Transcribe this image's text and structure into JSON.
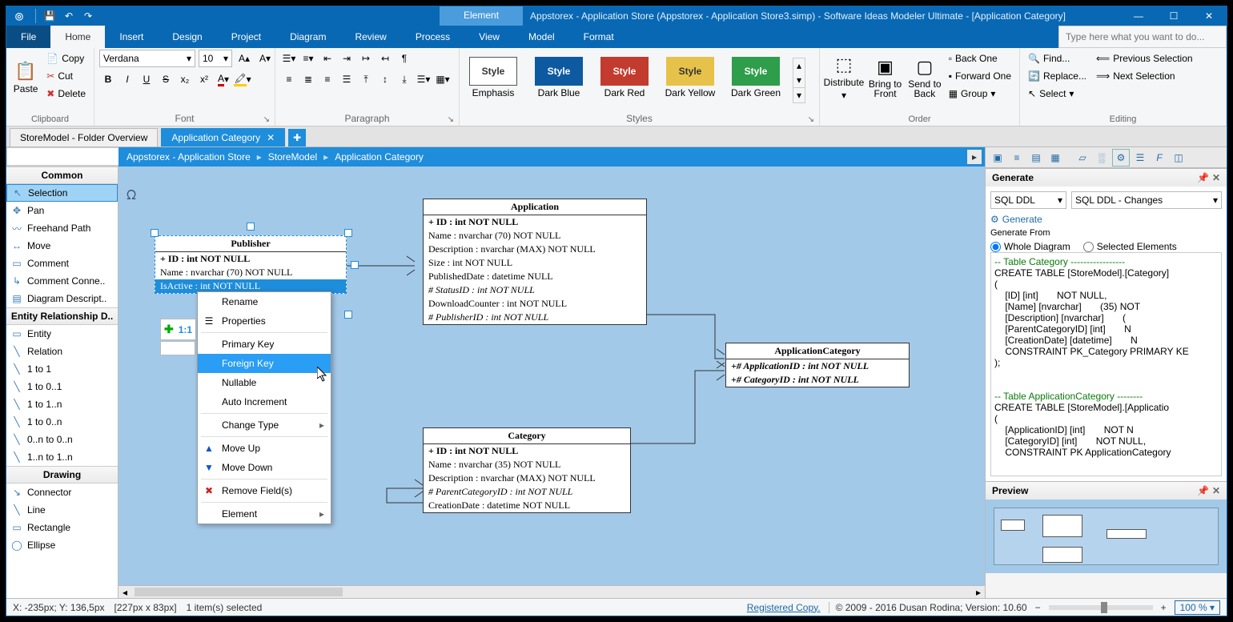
{
  "titlebar": {
    "context_tab": "Element",
    "title": "Appstorex - Application Store (Appstorex - Application Store3.simp)  - Software Ideas Modeler Ultimate - [Application Category]"
  },
  "menu": {
    "file": "File",
    "home": "Home",
    "insert": "Insert",
    "design": "Design",
    "project": "Project",
    "diagram": "Diagram",
    "review": "Review",
    "process": "Process",
    "view": "View",
    "model": "Model",
    "format": "Format",
    "search_placeholder": "Type here what you want to do..."
  },
  "ribbon": {
    "clipboard": {
      "paste": "Paste",
      "copy": "Copy",
      "cut": "Cut",
      "delete": "Delete",
      "title": "Clipboard"
    },
    "font": {
      "name": "Verdana",
      "size": "10",
      "title": "Font"
    },
    "paragraph": {
      "title": "Paragraph"
    },
    "styles": {
      "title": "Styles",
      "items": [
        {
          "label": "Emphasis",
          "box": "Style",
          "bg": "#ffffff",
          "color": "#333",
          "border": "#555"
        },
        {
          "label": "Dark Blue",
          "box": "Style",
          "bg": "#0d5aa0",
          "color": "#fff",
          "border": "#0d5aa0"
        },
        {
          "label": "Dark Red",
          "box": "Style",
          "bg": "#c23b2e",
          "color": "#fff",
          "border": "#c23b2e"
        },
        {
          "label": "Dark Yellow",
          "box": "Style",
          "bg": "#e6c24a",
          "color": "#333",
          "border": "#e6c24a"
        },
        {
          "label": "Dark Green",
          "box": "Style",
          "bg": "#2e9e4a",
          "color": "#fff",
          "border": "#2e9e4a"
        }
      ]
    },
    "order": {
      "distribute": "Distribute",
      "front": "Bring to\nFront",
      "back": "Send to\nBack",
      "back_one": "Back One",
      "forward_one": "Forward One",
      "group": "Group",
      "title": "Order"
    },
    "editing": {
      "find": "Find...",
      "replace": "Replace...",
      "select": "Select",
      "prev": "Previous Selection",
      "next": "Next Selection",
      "title": "Editing"
    }
  },
  "doctabs": {
    "tab1": "StoreModel - Folder Overview",
    "tab2": "Application Category"
  },
  "breadcrumb": {
    "a": "Appstorex - Application Store",
    "b": "StoreModel",
    "c": "Application Category"
  },
  "toolbox": {
    "headers": {
      "common": "Common",
      "erd": "Entity Relationship D..",
      "drawing": "Drawing"
    },
    "common": [
      "Selection",
      "Pan",
      "Freehand Path",
      "Move",
      "Comment",
      "Comment Conne..",
      "Diagram Descript.."
    ],
    "erd": [
      "Entity",
      "Relation",
      "1 to 1",
      "1 to 0..1",
      "1 to 1..n",
      "1 to 0..n",
      "0..n to 0..n",
      "1..n to 1..n"
    ],
    "drawing": [
      "Connector",
      "Line",
      "Rectangle",
      "Ellipse"
    ],
    "smart": "1:1"
  },
  "entities": {
    "publisher": {
      "name": "Publisher",
      "fields": [
        "+ ID : int NOT NULL",
        "Name : nvarchar (70)  NOT NULL",
        "IsActive : int NOT NULL"
      ]
    },
    "application": {
      "name": "Application",
      "fields": [
        "+ ID : int NOT NULL",
        "Name : nvarchar (70)  NOT NULL",
        "Description : nvarchar (MAX)  NOT NULL",
        "Size : int NOT NULL",
        "PublishedDate : datetime NULL",
        "# StatusID : int NOT NULL",
        "DownloadCounter : int NOT NULL",
        "# PublisherID : int NOT NULL"
      ]
    },
    "appcat": {
      "name": "ApplicationCategory",
      "fields": [
        "+# ApplicationID : int NOT NULL",
        "+# CategoryID : int NOT NULL"
      ]
    },
    "category": {
      "name": "Category",
      "fields": [
        "+ ID : int NOT NULL",
        "Name : nvarchar (35)  NOT NULL",
        "Description : nvarchar (MAX)  NOT NULL",
        "# ParentCategoryID : int NOT NULL",
        "CreationDate : datetime NOT NULL"
      ]
    }
  },
  "context_menu": {
    "rename": "Rename",
    "properties": "Properties",
    "primary_key": "Primary Key",
    "foreign_key": "Foreign Key",
    "nullable": "Nullable",
    "auto_inc": "Auto Increment",
    "change_type": "Change Type",
    "move_up": "Move Up",
    "move_down": "Move Down",
    "remove": "Remove Field(s)",
    "element": "Element"
  },
  "right": {
    "generate": {
      "title": "Generate",
      "combo1": "SQL DDL",
      "combo2": "SQL DDL - Changes",
      "link": "Generate",
      "from_label": "Generate From",
      "radio1": "Whole Diagram",
      "radio2": "Selected Elements"
    },
    "code_lines": [
      {
        "t": "-- Table Category -----------------",
        "c": true
      },
      {
        "t": "CREATE TABLE [StoreModel].[Category]"
      },
      {
        "t": "("
      },
      {
        "t": "    [ID] [int]       NOT NULL,"
      },
      {
        "t": "    [Name] [nvarchar]       (35) NOT"
      },
      {
        "t": "    [Description] [nvarchar]       ("
      },
      {
        "t": "    [ParentCategoryID] [int]       N"
      },
      {
        "t": "    [CreationDate] [datetime]       N"
      },
      {
        "t": "    CONSTRAINT PK_Category PRIMARY KE"
      },
      {
        "t": ");"
      },
      {
        "t": ""
      },
      {
        "t": ""
      },
      {
        "t": "-- Table ApplicationCategory --------",
        "c": true
      },
      {
        "t": "CREATE TABLE [StoreModel].[Applicatio"
      },
      {
        "t": "("
      },
      {
        "t": "    [ApplicationID] [int]       NOT N"
      },
      {
        "t": "    [CategoryID] [int]       NOT NULL,"
      },
      {
        "t": "    CONSTRAINT PK ApplicationCategory"
      }
    ],
    "preview": {
      "title": "Preview"
    }
  },
  "status": {
    "coords": "X: -235px; Y: 136,5px",
    "size": "[227px x 83px]",
    "sel": "1 item(s) selected",
    "registered": "Registered Copy.",
    "copyright": "© 2009 - 2016 Dusan Rodina; Version: 10.60",
    "zoom": "100 %"
  }
}
